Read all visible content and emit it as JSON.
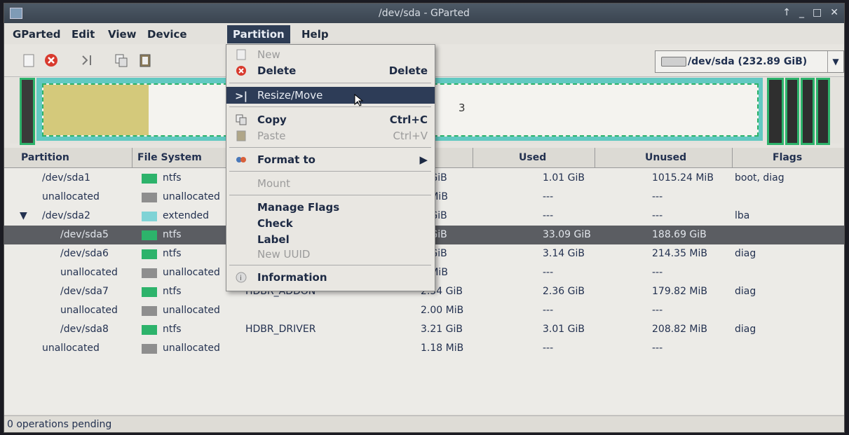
{
  "window": {
    "title": "/dev/sda - GParted"
  },
  "menubar": {
    "items": [
      "GParted",
      "Edit",
      "View",
      "Device",
      "Partition",
      "Help"
    ]
  },
  "device_selector": {
    "label": "/dev/sda  (232.89 GiB)"
  },
  "partition_menu": {
    "new": "New",
    "delete": "Delete",
    "delete_accel": "Delete",
    "resize": "Resize/Move",
    "copy": "Copy",
    "copy_accel": "Ctrl+C",
    "paste": "Paste",
    "paste_accel": "Ctrl+V",
    "format": "Format to",
    "mount": "Mount",
    "manage_flags": "Manage Flags",
    "check": "Check",
    "label": "Label",
    "new_uuid": "New UUID",
    "information": "Information"
  },
  "table": {
    "headers": [
      "Partition",
      "File System",
      "Used",
      "Unused",
      "Flags"
    ],
    "rows": [
      {
        "partition": "/dev/sda1",
        "fs": "ntfs",
        "label": "",
        "size": "0 GiB",
        "used": "1.01 GiB",
        "unused": "1015.24 MiB",
        "flags": "boot, diag",
        "color": "#2db36b"
      },
      {
        "partition": "unallocated",
        "fs": "unallocated",
        "label": "",
        "size": "0 MiB",
        "used": "---",
        "unused": "---",
        "flags": "",
        "color": "#8e8e8e"
      },
      {
        "partition": "/dev/sda2",
        "fs": "extended",
        "label": "",
        "size": "8 GiB",
        "used": "---",
        "unused": "---",
        "flags": "lba",
        "color": "#7fd3d6"
      },
      {
        "partition": "/dev/sda5",
        "fs": "ntfs",
        "label": "",
        "size": "3 GiB",
        "used": "33.09 GiB",
        "unused": "188.69 GiB",
        "flags": "",
        "color": "#2db36b"
      },
      {
        "partition": "/dev/sda6",
        "fs": "ntfs",
        "label": "",
        "size": "5 GiB",
        "used": "3.14 GiB",
        "unused": "214.35 MiB",
        "flags": "diag",
        "color": "#2db36b"
      },
      {
        "partition": "unallocated",
        "fs": "unallocated",
        "label": "",
        "size": "0 MiB",
        "used": "---",
        "unused": "---",
        "flags": "",
        "color": "#8e8e8e"
      },
      {
        "partition": "/dev/sda7",
        "fs": "ntfs",
        "label": "HDBR_ADDON",
        "size": "2.54 GiB",
        "used": "2.36 GiB",
        "unused": "179.82 MiB",
        "flags": "diag",
        "color": "#2db36b"
      },
      {
        "partition": "unallocated",
        "fs": "unallocated",
        "label": "",
        "size": "2.00 MiB",
        "used": "---",
        "unused": "---",
        "flags": "",
        "color": "#8e8e8e"
      },
      {
        "partition": "/dev/sda8",
        "fs": "ntfs",
        "label": "HDBR_DRIVER",
        "size": "3.21 GiB",
        "used": "3.01 GiB",
        "unused": "208.82 MiB",
        "flags": "diag",
        "color": "#2db36b"
      },
      {
        "partition": "unallocated",
        "fs": "unallocated",
        "label": "",
        "size": "1.18 MiB",
        "used": "---",
        "unused": "---",
        "flags": "",
        "color": "#8e8e8e"
      }
    ]
  },
  "diskmap": {
    "fragment": "3"
  },
  "status": {
    "text": "0 operations pending"
  },
  "colors": {
    "ntfs": "#2db36b",
    "unallocated": "#8e8e8e",
    "extended": "#7fd3d6",
    "menu_highlight": "#2d3c57"
  }
}
